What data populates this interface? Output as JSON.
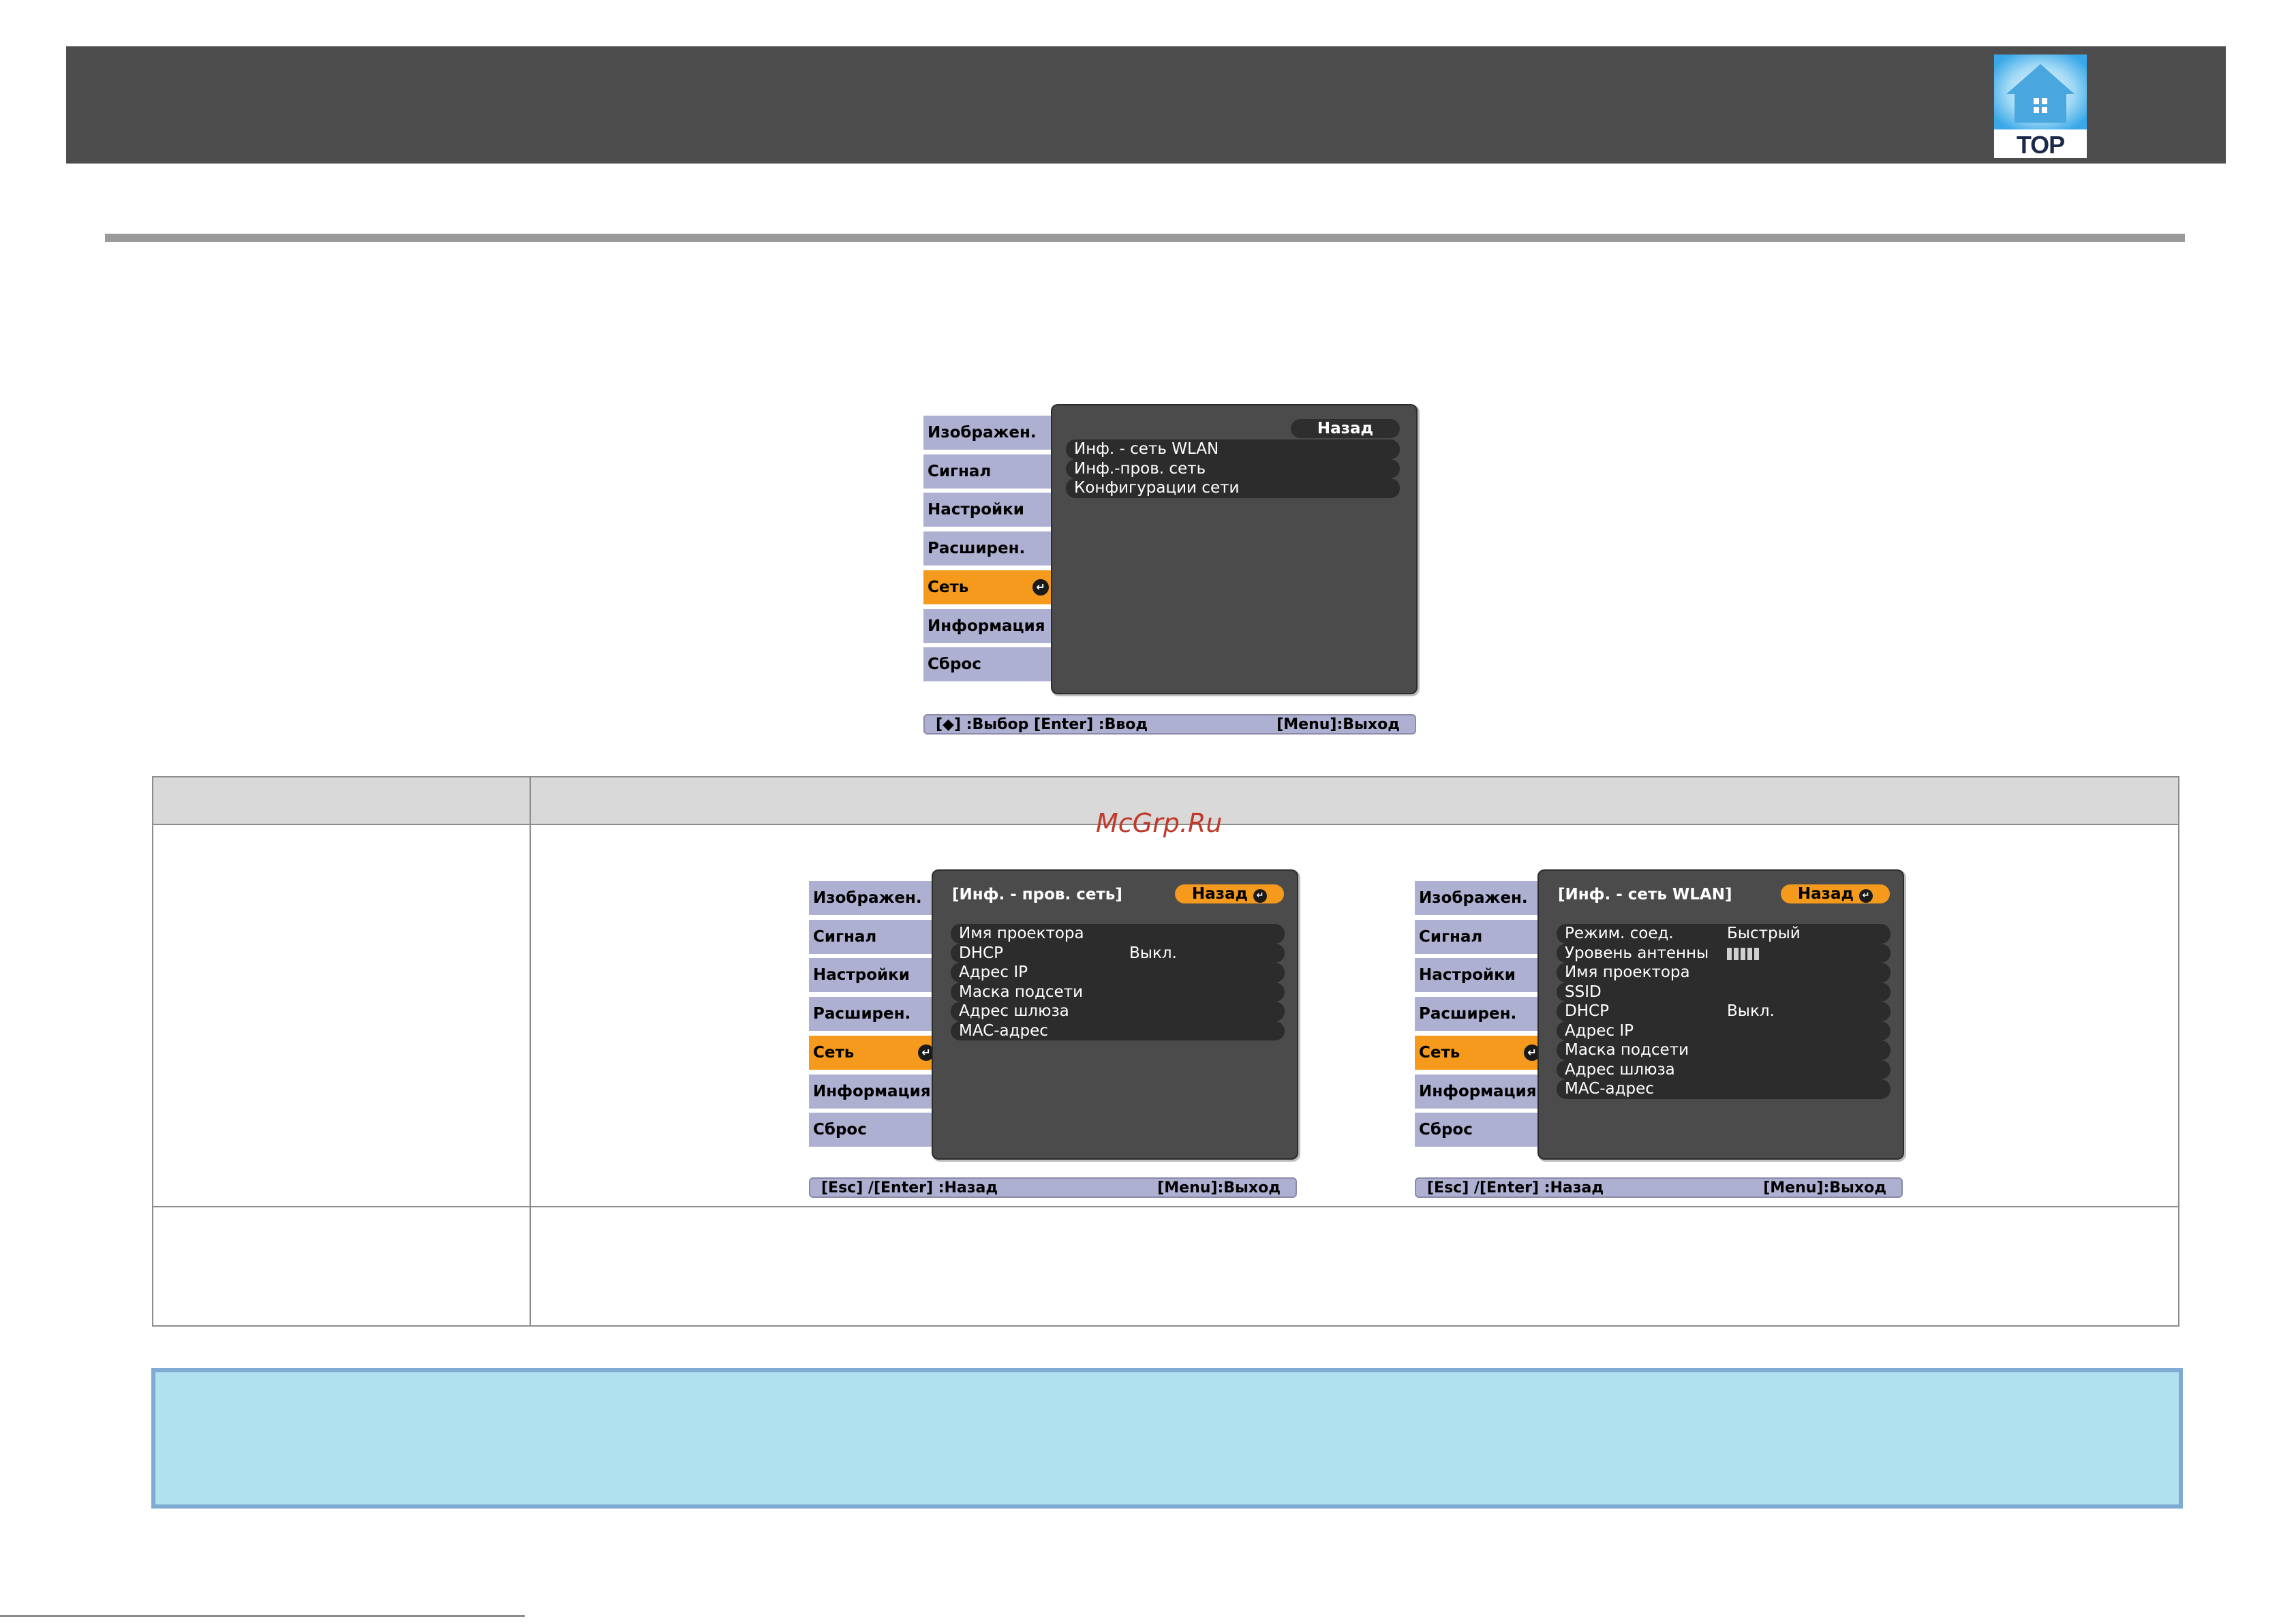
{
  "header": {
    "top_button_label": "TOP",
    "top_icon": "house-icon"
  },
  "watermark": "McGrp.Ru",
  "menu_main": {
    "tabs": [
      "Изображен.",
      "Сигнал",
      "Настройки",
      "Расширен.",
      "Сеть",
      "Информация",
      "Сброс"
    ],
    "active_tab": "Сеть",
    "back_label": "Назад",
    "items": [
      "Инф. - сеть WLAN",
      "Инф.-пров. сеть",
      "Конфигурации сети"
    ],
    "hint_left": "[◆] :Выбор  [Enter] :Ввод",
    "hint_right": "[Menu]:Выход"
  },
  "menu_wired": {
    "tabs": [
      "Изображен.",
      "Сигнал",
      "Настройки",
      "Расширен.",
      "Сеть",
      "Информация",
      "Сброс"
    ],
    "title": "[Инф. - пров. сеть]",
    "back_label": "Назад",
    "rows": [
      {
        "label": "Имя проектора",
        "value": ""
      },
      {
        "label": "DHCP",
        "value": "Выкл."
      },
      {
        "label": "Адрес IP",
        "value": ""
      },
      {
        "label": "Маска подсети",
        "value": ""
      },
      {
        "label": "Адрес шлюза",
        "value": ""
      },
      {
        "label": "MAC-адрес",
        "value": ""
      }
    ],
    "hint_left": "[Esc] /[Enter] :Назад",
    "hint_right": "[Menu]:Выход"
  },
  "menu_wlan": {
    "tabs": [
      "Изображен.",
      "Сигнал",
      "Настройки",
      "Расширен.",
      "Сеть",
      "Информация",
      "Сброс"
    ],
    "title": "[Инф. - сеть WLAN]",
    "back_label": "Назад",
    "rows": [
      {
        "label": "Режим. соед.",
        "value": "Быстрый"
      },
      {
        "label": "Уровень антенны",
        "value": ""
      },
      {
        "label": "Имя проектора",
        "value": ""
      },
      {
        "label": "SSID",
        "value": ""
      },
      {
        "label": "DHCP",
        "value": "Выкл."
      },
      {
        "label": "Адрес IP",
        "value": ""
      },
      {
        "label": "Маска подсети",
        "value": ""
      },
      {
        "label": "Адрес шлюза",
        "value": ""
      },
      {
        "label": "MAC-адрес",
        "value": ""
      }
    ],
    "antenna_level_bars": 5,
    "hint_left": "[Esc] /[Enter] :Назад",
    "hint_right": "[Menu]:Выход"
  },
  "colors": {
    "header": "#4d4d4d",
    "active_tab": "#f59a1c",
    "tab": "#aeb0d2",
    "panel": "#4b4b4b",
    "note": "#b0e1ee",
    "note_border": "#7faad2"
  }
}
